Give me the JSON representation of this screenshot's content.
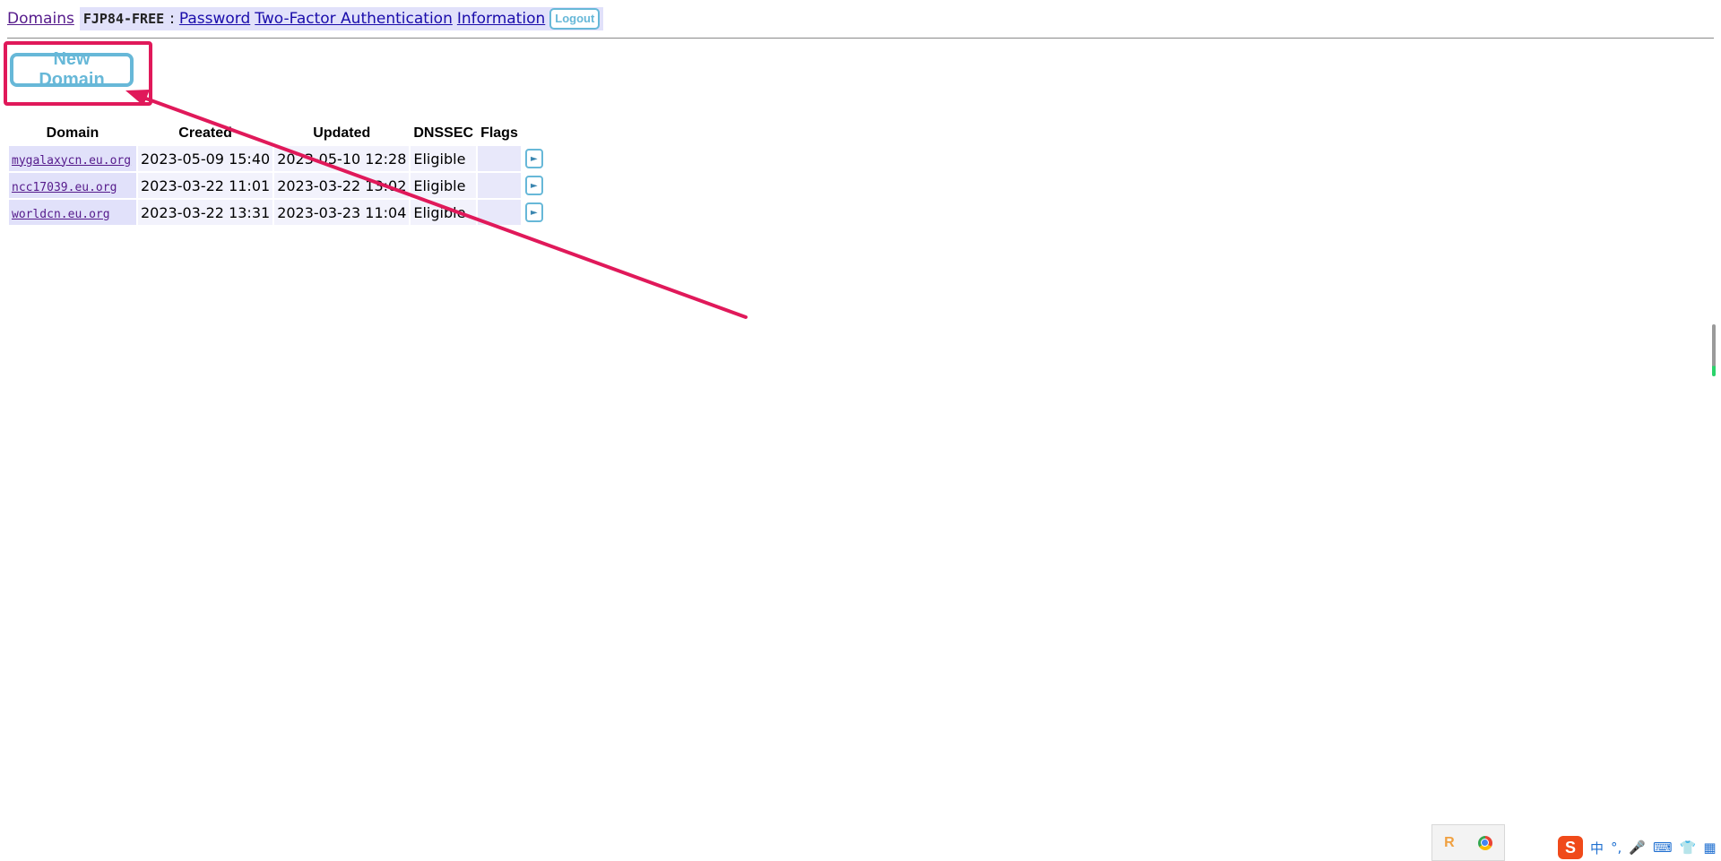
{
  "nav": {
    "domains_link": "Domains",
    "handle": "FJP84-FREE",
    "separator": ":",
    "password_link": "Password",
    "twofa_link": "Two-Factor Authentication",
    "info_link": "Information",
    "logout_label": "Logout"
  },
  "actions": {
    "new_domain_label": "New Domain"
  },
  "table": {
    "headers": [
      "Domain",
      "Created",
      "Updated",
      "DNSSEC",
      "Flags"
    ],
    "rows": [
      {
        "domain": "mygalaxycn.eu.org",
        "created": "2023-05-09 15:40",
        "updated": "2023-05-10 12:28",
        "dnssec": "Eligible",
        "flags": ""
      },
      {
        "domain": "ncc17039.eu.org",
        "created": "2023-03-22 11:01",
        "updated": "2023-03-22 13:02",
        "dnssec": "Eligible",
        "flags": ""
      },
      {
        "domain": "worldcn.eu.org",
        "created": "2023-03-22 13:31",
        "updated": "2023-03-23 11:04",
        "dnssec": "Eligible",
        "flags": ""
      }
    ]
  },
  "annotation": {
    "color": "#e0195a"
  },
  "tray": {
    "app1_letter": "R",
    "ime_logo": "S",
    "ime_lang": "中"
  },
  "colors": {
    "link": "#1a0dab",
    "visited": "#551a8b",
    "button_accent": "#67b8d8",
    "row_bg": "#e1e1fa"
  }
}
